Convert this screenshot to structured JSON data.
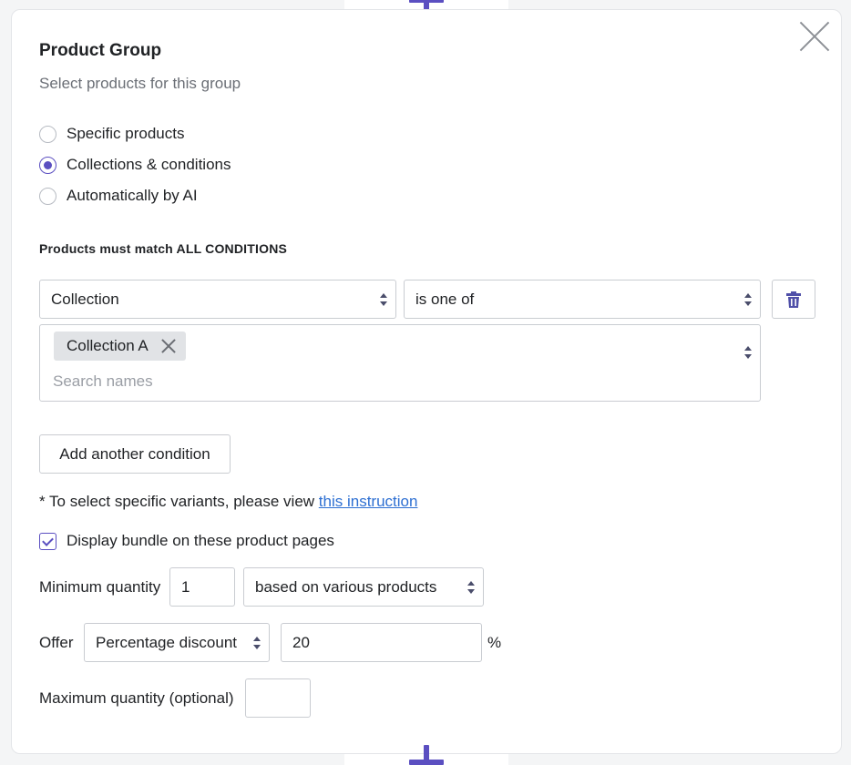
{
  "dialog": {
    "title": "Product Group",
    "subtitle": "Select products for this group"
  },
  "selection_mode": {
    "options": [
      {
        "label": "Specific products",
        "checked": false
      },
      {
        "label": "Collections & conditions",
        "checked": true
      },
      {
        "label": "Automatically by AI",
        "checked": false
      }
    ]
  },
  "conditions": {
    "heading": "Products must match ALL CONDITIONS",
    "field_select": "Collection",
    "operator_select": "is one of",
    "tags": [
      "Collection A"
    ],
    "search_placeholder": "Search names",
    "add_button": "Add another condition"
  },
  "note": {
    "prefix": "* To select specific variants, please view ",
    "link": "this instruction"
  },
  "display_bundle": {
    "label": "Display bundle on these product pages",
    "checked": true
  },
  "minimum_quantity": {
    "label": "Minimum quantity",
    "value": "1",
    "basis": "based on various products"
  },
  "offer": {
    "label": "Offer",
    "type": "Percentage discount",
    "value": "20",
    "unit": "%"
  },
  "maximum_quantity": {
    "label": "Maximum quantity (optional)",
    "value": ""
  },
  "colors": {
    "accent": "#5b4fc1",
    "link": "#2d6fd2"
  }
}
